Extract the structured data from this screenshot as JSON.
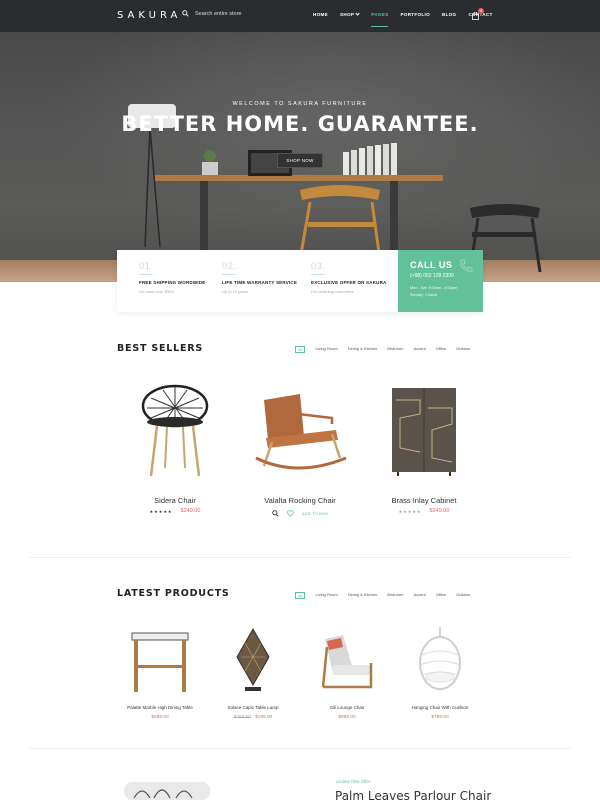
{
  "header": {
    "logo": "SAKURA",
    "search_placeholder": "Search entire store",
    "nav": [
      {
        "label": "HOME",
        "active": false
      },
      {
        "label": "SHOP",
        "active": false,
        "dropdown": true
      },
      {
        "label": "PAGES",
        "active": true
      },
      {
        "label": "PORTFOLIO",
        "active": false
      },
      {
        "label": "BLOG",
        "active": false
      },
      {
        "label": "CONTACT",
        "active": false
      }
    ],
    "cart_count": "0",
    "icons": [
      "search-icon",
      "cart-icon"
    ]
  },
  "hero": {
    "subtitle": "WELCOME TO SAKURA FURNITURE",
    "title": "BETTER HOME. GUARANTEE.",
    "button": "SHOP NOW"
  },
  "info": [
    {
      "num": "01.",
      "title": "FREE SHIPPING WORDWIDE",
      "desc": "On order over $500"
    },
    {
      "num": "02.",
      "title": "LIFE TIME WARRANTY SERVICE",
      "desc": "Up to 10 years"
    },
    {
      "num": "03.",
      "title": "EXCLUSIVE OFFER ON SAKURA",
      "desc": "For returning customers"
    }
  ],
  "callus": {
    "title": "CALL US",
    "phone": "(+98) 052 128 2300",
    "hours1": "Mon - Sat: 8:00am - 6:00pm",
    "hours2": "Sunday: Closed"
  },
  "best_sellers": {
    "title": "BEST SELLERS",
    "filters": [
      "All",
      "Living Room",
      "Dining & Kitchen",
      "Bedroom",
      "Accent",
      "Office",
      "Outdoor"
    ],
    "active_filter": "All",
    "items": [
      {
        "name": "Sidera Chair",
        "price": "$249.00",
        "stars": "★★★★★"
      },
      {
        "name": "Valalta Rocking Chair",
        "action_label": "ADD TO BAG"
      },
      {
        "name": "Brass Inlay Cabinet",
        "price": "$249.00",
        "stars": "★★★★★"
      }
    ]
  },
  "latest_products": {
    "title": "LATEST PRODUCTS",
    "filters": [
      "All",
      "Living Room",
      "Dining & Kitchen",
      "Bedroom",
      "Accent",
      "Office",
      "Outdoor"
    ],
    "active_filter": "All",
    "items": [
      {
        "name": "Palatte Marble High Dining Table",
        "price": "$598.00"
      },
      {
        "name": "Solace Capiz Table Lamp",
        "old_price": "$259.00",
        "price": "$198.00"
      },
      {
        "name": "Gili Lounge Chair",
        "price": "$698.00"
      },
      {
        "name": "Hanging Chair With Cushion",
        "price": "$798.00"
      }
    ]
  },
  "bottom": {
    "limited": "Limited Time Offer",
    "product": "Palm Leaves Parlour Chair"
  },
  "colors": {
    "accent": "#5dbf9b",
    "price": "#e26a62",
    "header_bg": "#2a2c30"
  }
}
